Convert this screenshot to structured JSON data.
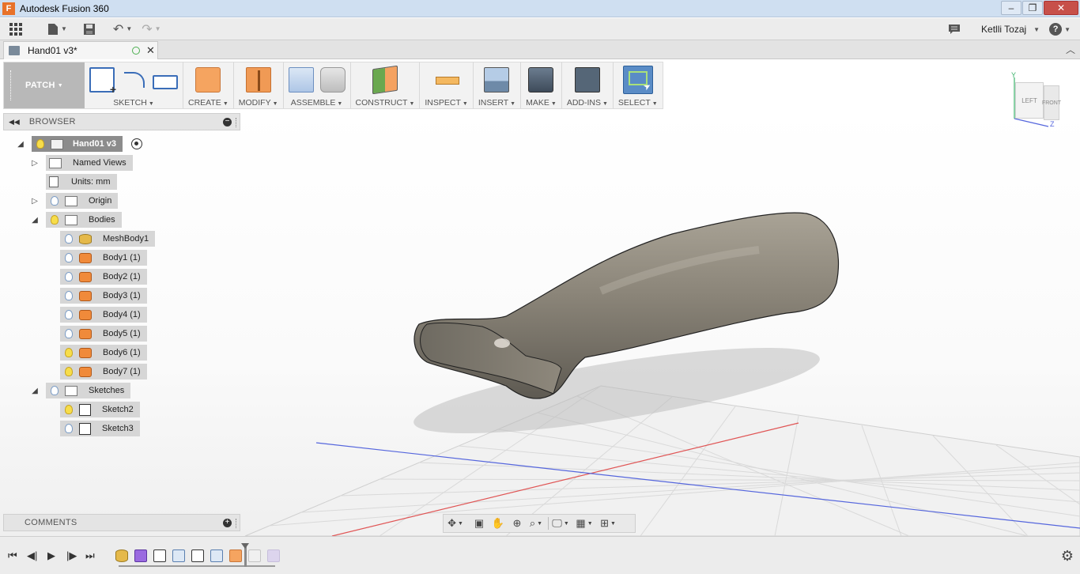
{
  "window": {
    "app_logo": "F",
    "title": "Autodesk Fusion 360",
    "controls": [
      "‒",
      "❐",
      "✕"
    ]
  },
  "quick_access": {
    "user": "Ketlli Tozaj",
    "help": "?"
  },
  "document_tab": {
    "title": "Hand01 v3*",
    "close": "✕"
  },
  "toolbar": {
    "workspace": "PATCH",
    "groups": [
      {
        "label": "SKETCH"
      },
      {
        "label": "CREATE"
      },
      {
        "label": "MODIFY"
      },
      {
        "label": "ASSEMBLE"
      },
      {
        "label": "CONSTRUCT"
      },
      {
        "label": "INSPECT"
      },
      {
        "label": "INSERT"
      },
      {
        "label": "MAKE"
      },
      {
        "label": "ADD-INS"
      },
      {
        "label": "SELECT"
      }
    ]
  },
  "browser": {
    "title": "BROWSER",
    "root": "Hand01 v3",
    "named_views": "Named Views",
    "units": "Units: mm",
    "origin": "Origin",
    "bodies": "Bodies",
    "body_items": [
      "MeshBody1",
      "Body1 (1)",
      "Body2 (1)",
      "Body3 (1)",
      "Body4 (1)",
      "Body5 (1)",
      "Body6 (1)",
      "Body7 (1)"
    ],
    "sketches": "Sketches",
    "sketch_items": [
      "Sketch2",
      "Sketch3"
    ]
  },
  "comments": {
    "title": "COMMENTS"
  },
  "viewcube": {
    "left": "LEFT",
    "front": "FRONT",
    "axis_y": "Y",
    "axis_z": "Z"
  },
  "colors": {
    "x_axis": "#e05555",
    "z_axis": "#5566dd",
    "body": "#7d776d",
    "accent": "#e8722a"
  }
}
